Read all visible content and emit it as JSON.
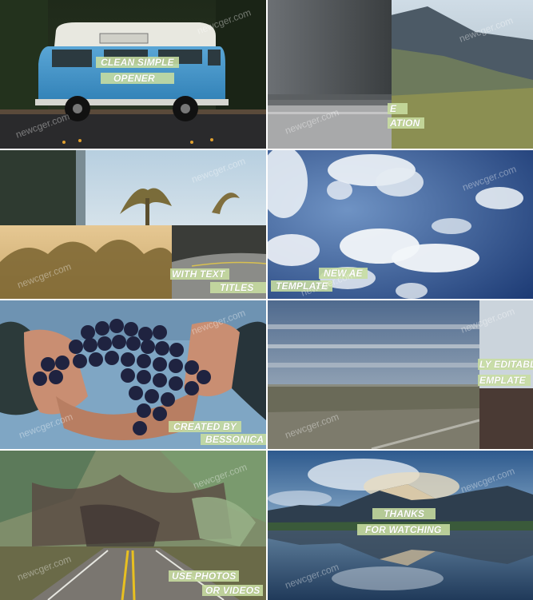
{
  "watermark": "newcger.com",
  "colors": {
    "label_bg": "#c8dea0",
    "label_text": "#ffffff",
    "gap": "#ffffff"
  },
  "tiles": [
    {
      "scene": "blue vintage van parked on street",
      "labels": [
        "CLEAN SIMPLE",
        "OPENER"
      ]
    },
    {
      "scene": "road and mountains with motion blur",
      "labels": [
        "E",
        "ATION"
      ]
    },
    {
      "scene": "palm trees and road split transition",
      "labels": [
        "WITH TEXT",
        "TITLES"
      ]
    },
    {
      "scene": "blue sky with white clouds",
      "labels": [
        "NEW AE",
        "TEMPLATE"
      ]
    },
    {
      "scene": "hands holding dark grapes",
      "labels": [
        "CREATED BY",
        "BESSONICA"
      ]
    },
    {
      "scene": "open field with motion blur",
      "labels": [
        "LY EDITABL",
        "EMPLATE"
      ]
    },
    {
      "scene": "blurred road with yellow lines",
      "labels": [
        "USE PHOTOS",
        "OR VIDEOS"
      ]
    },
    {
      "scene": "mountain lake reflection",
      "labels": [
        "THANKS",
        "FOR WATCHING"
      ]
    }
  ]
}
